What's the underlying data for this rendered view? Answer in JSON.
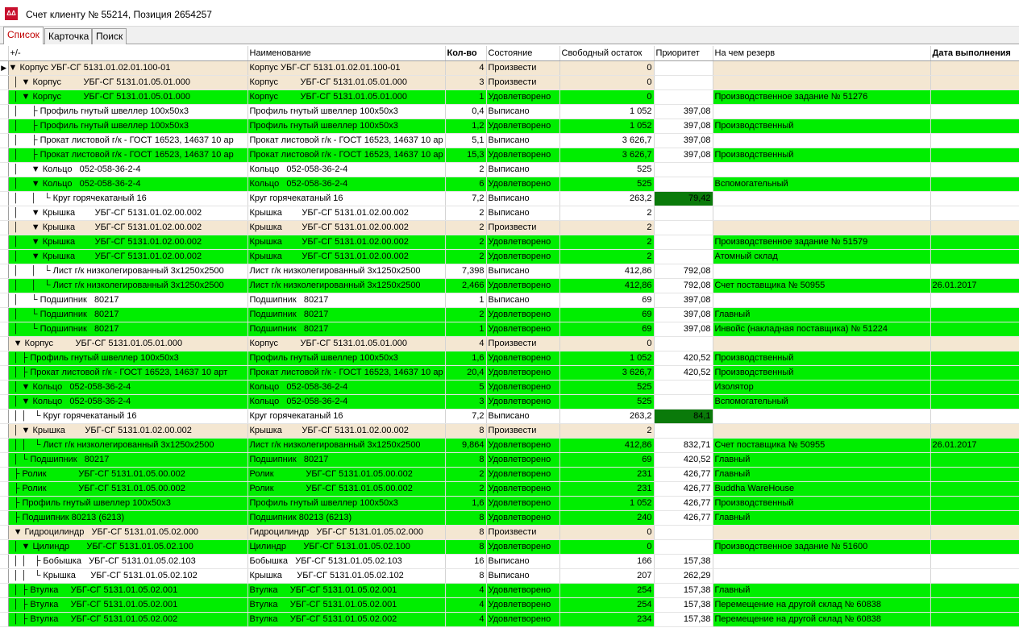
{
  "window": {
    "title": "Счет клиенту № 55214, Позиция 2654257",
    "icon_text": "ΔΔ"
  },
  "tabs": [
    "Список",
    "Карточка",
    "Поиск"
  ],
  "columns": [
    "+/-",
    "Наименование",
    "Кол-во",
    "Состояние",
    "Свободный остаток",
    "Приоритет",
    "На чем резерв",
    "Дата выполнения"
  ],
  "rows": [
    {
      "tree": "▼ Корпус УБГ-СГ 5131.01.02.01.100-01",
      "name": "Корпус УБГ-СГ 5131.01.02.01.100-01",
      "qty": "4",
      "state": "Произвести",
      "stock": "0",
      "priority": "",
      "reserve": "",
      "date": "",
      "color": "beige",
      "marker": "▶"
    },
    {
      "tree": "  │ ▼ Корпус         УБГ-СГ 5131.01.05.01.000",
      "name": "Корпус         УБГ-СГ 5131.01.05.01.000",
      "qty": "3",
      "state": "Произвести",
      "stock": "0",
      "priority": "",
      "reserve": "",
      "date": "",
      "color": "beige"
    },
    {
      "tree": "  │ ▼ Корпус         УБГ-СГ 5131.01.05.01.000",
      "name": "Корпус         УБГ-СГ 5131.01.05.01.000",
      "qty": "1",
      "state": "Удовлетворено",
      "stock": "0",
      "priority": "",
      "reserve": "Производственное задание № 51276",
      "date": "",
      "color": "green"
    },
    {
      "tree": "  │     ├ Профиль гнутый швеллер 100х50х3",
      "name": "Профиль гнутый швеллер 100х50х3",
      "qty": "0,4",
      "state": "Выписано",
      "stock": "1 052",
      "priority": "397,08",
      "reserve": "",
      "date": "",
      "color": "white"
    },
    {
      "tree": "  │     ├ Профиль гнутый швеллер 100х50х3",
      "name": "Профиль гнутый швеллер 100х50х3",
      "qty": "1,2",
      "state": "Удовлетворено",
      "stock": "1 052",
      "priority": "397,08",
      "reserve": "Производственный",
      "date": "",
      "color": "green"
    },
    {
      "tree": "  │     ├ Прокат листовой г/к - ГОСТ 16523, 14637 10 ар",
      "name": "Прокат листовой г/к - ГОСТ 16523, 14637 10 ар",
      "qty": "5,1",
      "state": "Выписано",
      "stock": "3 626,7",
      "priority": "397,08",
      "reserve": "",
      "date": "",
      "color": "white"
    },
    {
      "tree": "  │     ├ Прокат листовой г/к - ГОСТ 16523, 14637 10 ар",
      "name": "Прокат листовой г/к - ГОСТ 16523, 14637 10 ар",
      "qty": "15,3",
      "state": "Удовлетворено",
      "stock": "3 626,7",
      "priority": "397,08",
      "reserve": "Производственный",
      "date": "",
      "color": "green"
    },
    {
      "tree": "  │     ▼ Кольцо   052-058-36-2-4",
      "name": "Кольцо   052-058-36-2-4",
      "qty": "2",
      "state": "Выписано",
      "stock": "525",
      "priority": "",
      "reserve": "",
      "date": "",
      "color": "white"
    },
    {
      "tree": "  │     ▼ Кольцо   052-058-36-2-4",
      "name": "Кольцо   052-058-36-2-4",
      "qty": "6",
      "state": "Удовлетворено",
      "stock": "525",
      "priority": "",
      "reserve": "Вспомогательный",
      "date": "",
      "color": "green"
    },
    {
      "tree": "  │     │   └ Круг горячекатаный 16",
      "name": "Круг горячекатаный 16",
      "qty": "7,2",
      "state": "Выписано",
      "stock": "263,2",
      "priority": "79,42",
      "reserve": "",
      "date": "",
      "color": "white",
      "prio_dark": true
    },
    {
      "tree": "  │     ▼ Крышка        УБГ-СГ 5131.01.02.00.002",
      "name": "Крышка        УБГ-СГ 5131.01.02.00.002",
      "qty": "2",
      "state": "Выписано",
      "stock": "2",
      "priority": "",
      "reserve": "",
      "date": "",
      "color": "white"
    },
    {
      "tree": "  │     ▼ Крышка        УБГ-СГ 5131.01.02.00.002",
      "name": "Крышка        УБГ-СГ 5131.01.02.00.002",
      "qty": "2",
      "state": "Произвести",
      "stock": "2",
      "priority": "",
      "reserve": "",
      "date": "",
      "color": "beige"
    },
    {
      "tree": "  │     ▼ Крышка        УБГ-СГ 5131.01.02.00.002",
      "name": "Крышка        УБГ-СГ 5131.01.02.00.002",
      "qty": "2",
      "state": "Удовлетворено",
      "stock": "2",
      "priority": "",
      "reserve": "Производственное задание № 51579",
      "date": "",
      "color": "green"
    },
    {
      "tree": "  │     ▼ Крышка        УБГ-СГ 5131.01.02.00.002",
      "name": "Крышка        УБГ-СГ 5131.01.02.00.002",
      "qty": "2",
      "state": "Удовлетворено",
      "stock": "2",
      "priority": "",
      "reserve": "Атомный склад",
      "date": "",
      "color": "green"
    },
    {
      "tree": "  │     │   └ Лист г/к низколегированный 3х1250х2500",
      "name": "Лист г/к низколегированный 3х1250х2500",
      "qty": "7,398",
      "state": "Выписано",
      "stock": "412,86",
      "priority": "792,08",
      "reserve": "",
      "date": "",
      "color": "white"
    },
    {
      "tree": "  │     │   └ Лист г/к низколегированный 3х1250х2500",
      "name": "Лист г/к низколегированный 3х1250х2500",
      "qty": "2,466",
      "state": "Удовлетворено",
      "stock": "412,86",
      "priority": "792,08",
      "reserve": "Счет поставщика № 50955",
      "date": "26.01.2017",
      "color": "green"
    },
    {
      "tree": "  │     └ Подшипник   80217",
      "name": "Подшипник   80217",
      "qty": "1",
      "state": "Выписано",
      "stock": "69",
      "priority": "397,08",
      "reserve": "",
      "date": "",
      "color": "white"
    },
    {
      "tree": "  │     └ Подшипник   80217",
      "name": "Подшипник   80217",
      "qty": "2",
      "state": "Удовлетворено",
      "stock": "69",
      "priority": "397,08",
      "reserve": "Главный",
      "date": "",
      "color": "green"
    },
    {
      "tree": "  │     └ Подшипник   80217",
      "name": "Подшипник   80217",
      "qty": "1",
      "state": "Удовлетворено",
      "stock": "69",
      "priority": "397,08",
      "reserve": "Инвойс (накладная поставщика) № 51224",
      "date": "",
      "color": "green"
    },
    {
      "tree": "  ▼ Корпус         УБГ-СГ 5131.01.05.01.000",
      "name": "Корпус         УБГ-СГ 5131.01.05.01.000",
      "qty": "4",
      "state": "Произвести",
      "stock": "0",
      "priority": "",
      "reserve": "",
      "date": "",
      "color": "beige"
    },
    {
      "tree": "  │ ├ Профиль гнутый швеллер 100х50х3",
      "name": "Профиль гнутый швеллер 100х50х3",
      "qty": "1,6",
      "state": "Удовлетворено",
      "stock": "1 052",
      "priority": "420,52",
      "reserve": "Производственный",
      "date": "",
      "color": "green"
    },
    {
      "tree": "  │ ├ Прокат листовой г/к - ГОСТ 16523, 14637 10 арт",
      "name": "Прокат листовой г/к - ГОСТ 16523, 14637 10 ар",
      "qty": "20,4",
      "state": "Удовлетворено",
      "stock": "3 626,7",
      "priority": "420,52",
      "reserve": "Производственный",
      "date": "",
      "color": "green"
    },
    {
      "tree": "  │ ▼ Кольцо   052-058-36-2-4",
      "name": "Кольцо   052-058-36-2-4",
      "qty": "5",
      "state": "Удовлетворено",
      "stock": "525",
      "priority": "",
      "reserve": "Изолятор",
      "date": "",
      "color": "green"
    },
    {
      "tree": "  │ ▼ Кольцо   052-058-36-2-4",
      "name": "Кольцо   052-058-36-2-4",
      "qty": "3",
      "state": "Удовлетворено",
      "stock": "525",
      "priority": "",
      "reserve": "Вспомогательный",
      "date": "",
      "color": "green"
    },
    {
      "tree": "  │ │   └ Круг горячекатаный 16",
      "name": "Круг горячекатаный 16",
      "qty": "7,2",
      "state": "Выписано",
      "stock": "263,2",
      "priority": "84,1",
      "reserve": "",
      "date": "",
      "color": "white",
      "prio_dark": true
    },
    {
      "tree": "  │ ▼ Крышка        УБГ-СГ 5131.01.02.00.002",
      "name": "Крышка        УБГ-СГ 5131.01.02.00.002",
      "qty": "8",
      "state": "Произвести",
      "stock": "2",
      "priority": "",
      "reserve": "",
      "date": "",
      "color": "beige"
    },
    {
      "tree": "  │ │   └ Лист г/к низколегированный 3х1250х2500",
      "name": "Лист г/к низколегированный 3х1250х2500",
      "qty": "9,864",
      "state": "Удовлетворено",
      "stock": "412,86",
      "priority": "832,71",
      "reserve": "Счет поставщика № 50955",
      "date": "26.01.2017",
      "color": "green"
    },
    {
      "tree": "  │ └ Подшипник   80217",
      "name": "Подшипник   80217",
      "qty": "8",
      "state": "Удовлетворено",
      "stock": "69",
      "priority": "420,52",
      "reserve": "Главный",
      "date": "",
      "color": "green"
    },
    {
      "tree": "  ├ Ролик             УБГ-СГ 5131.01.05.00.002",
      "name": "Ролик             УБГ-СГ 5131.01.05.00.002",
      "qty": "2",
      "state": "Удовлетворено",
      "stock": "231",
      "priority": "426,77",
      "reserve": "Главный",
      "date": "",
      "color": "green"
    },
    {
      "tree": "  ├ Ролик             УБГ-СГ 5131.01.05.00.002",
      "name": "Ролик             УБГ-СГ 5131.01.05.00.002",
      "qty": "2",
      "state": "Удовлетворено",
      "stock": "231",
      "priority": "426,77",
      "reserve": "Buddha WareHouse",
      "date": "",
      "color": "green"
    },
    {
      "tree": "  ├ Профиль гнутый швеллер 100х50х3",
      "name": "Профиль гнутый швеллер 100х50х3",
      "qty": "1,6",
      "state": "Удовлетворено",
      "stock": "1 052",
      "priority": "426,77",
      "reserve": "Производственный",
      "date": "",
      "color": "green"
    },
    {
      "tree": "  ├ Подшипник 80213 (6213)",
      "name": "Подшипник 80213 (6213)",
      "qty": "8",
      "state": "Удовлетворено",
      "stock": "240",
      "priority": "426,77",
      "reserve": "Главный",
      "date": "",
      "color": "green"
    },
    {
      "tree": "  ▼ Гидроцилиндр   УБГ-СГ 5131.01.05.02.000",
      "name": "Гидроцилиндр   УБГ-СГ 5131.01.05.02.000",
      "qty": "8",
      "state": "Произвести",
      "stock": "0",
      "priority": "",
      "reserve": "",
      "date": "",
      "color": "beige"
    },
    {
      "tree": "  │ ▼ Цилиндр       УБГ-СГ 5131.01.05.02.100",
      "name": "Цилиндр       УБГ-СГ 5131.01.05.02.100",
      "qty": "8",
      "state": "Удовлетворено",
      "stock": "0",
      "priority": "",
      "reserve": "Производственное задание № 51600",
      "date": "",
      "color": "green"
    },
    {
      "tree": "  │ │   ├ Бобышка   УБГ-СГ 5131.01.05.02.103",
      "name": "Бобышка   УБГ-СГ 5131.01.05.02.103",
      "qty": "16",
      "state": "Выписано",
      "stock": "166",
      "priority": "157,38",
      "reserve": "",
      "date": "",
      "color": "white"
    },
    {
      "tree": "  │ │   └ Крышка      УБГ-СГ 5131.01.05.02.102",
      "name": "Крышка      УБГ-СГ 5131.01.05.02.102",
      "qty": "8",
      "state": "Выписано",
      "stock": "207",
      "priority": "262,29",
      "reserve": "",
      "date": "",
      "color": "white"
    },
    {
      "tree": "  │ ├ Втулка     УБГ-СГ 5131.01.05.02.001",
      "name": "Втулка     УБГ-СГ 5131.01.05.02.001",
      "qty": "4",
      "state": "Удовлетворено",
      "stock": "254",
      "priority": "157,38",
      "reserve": "Главный",
      "date": "",
      "color": "green"
    },
    {
      "tree": "  │ ├ Втулка     УБГ-СГ 5131.01.05.02.001",
      "name": "Втулка     УБГ-СГ 5131.01.05.02.001",
      "qty": "4",
      "state": "Удовлетворено",
      "stock": "254",
      "priority": "157,38",
      "reserve": "Перемещение на другой склад № 60838",
      "date": "",
      "color": "green"
    },
    {
      "tree": "  │ ├ Втулка     УБГ-СГ 5131.01.05.02.002",
      "name": "Втулка     УБГ-СГ 5131.01.05.02.002",
      "qty": "4",
      "state": "Удовлетворено",
      "stock": "234",
      "priority": "157,38",
      "reserve": "Перемещение на другой склад № 60838",
      "date": "",
      "color": "green"
    }
  ]
}
